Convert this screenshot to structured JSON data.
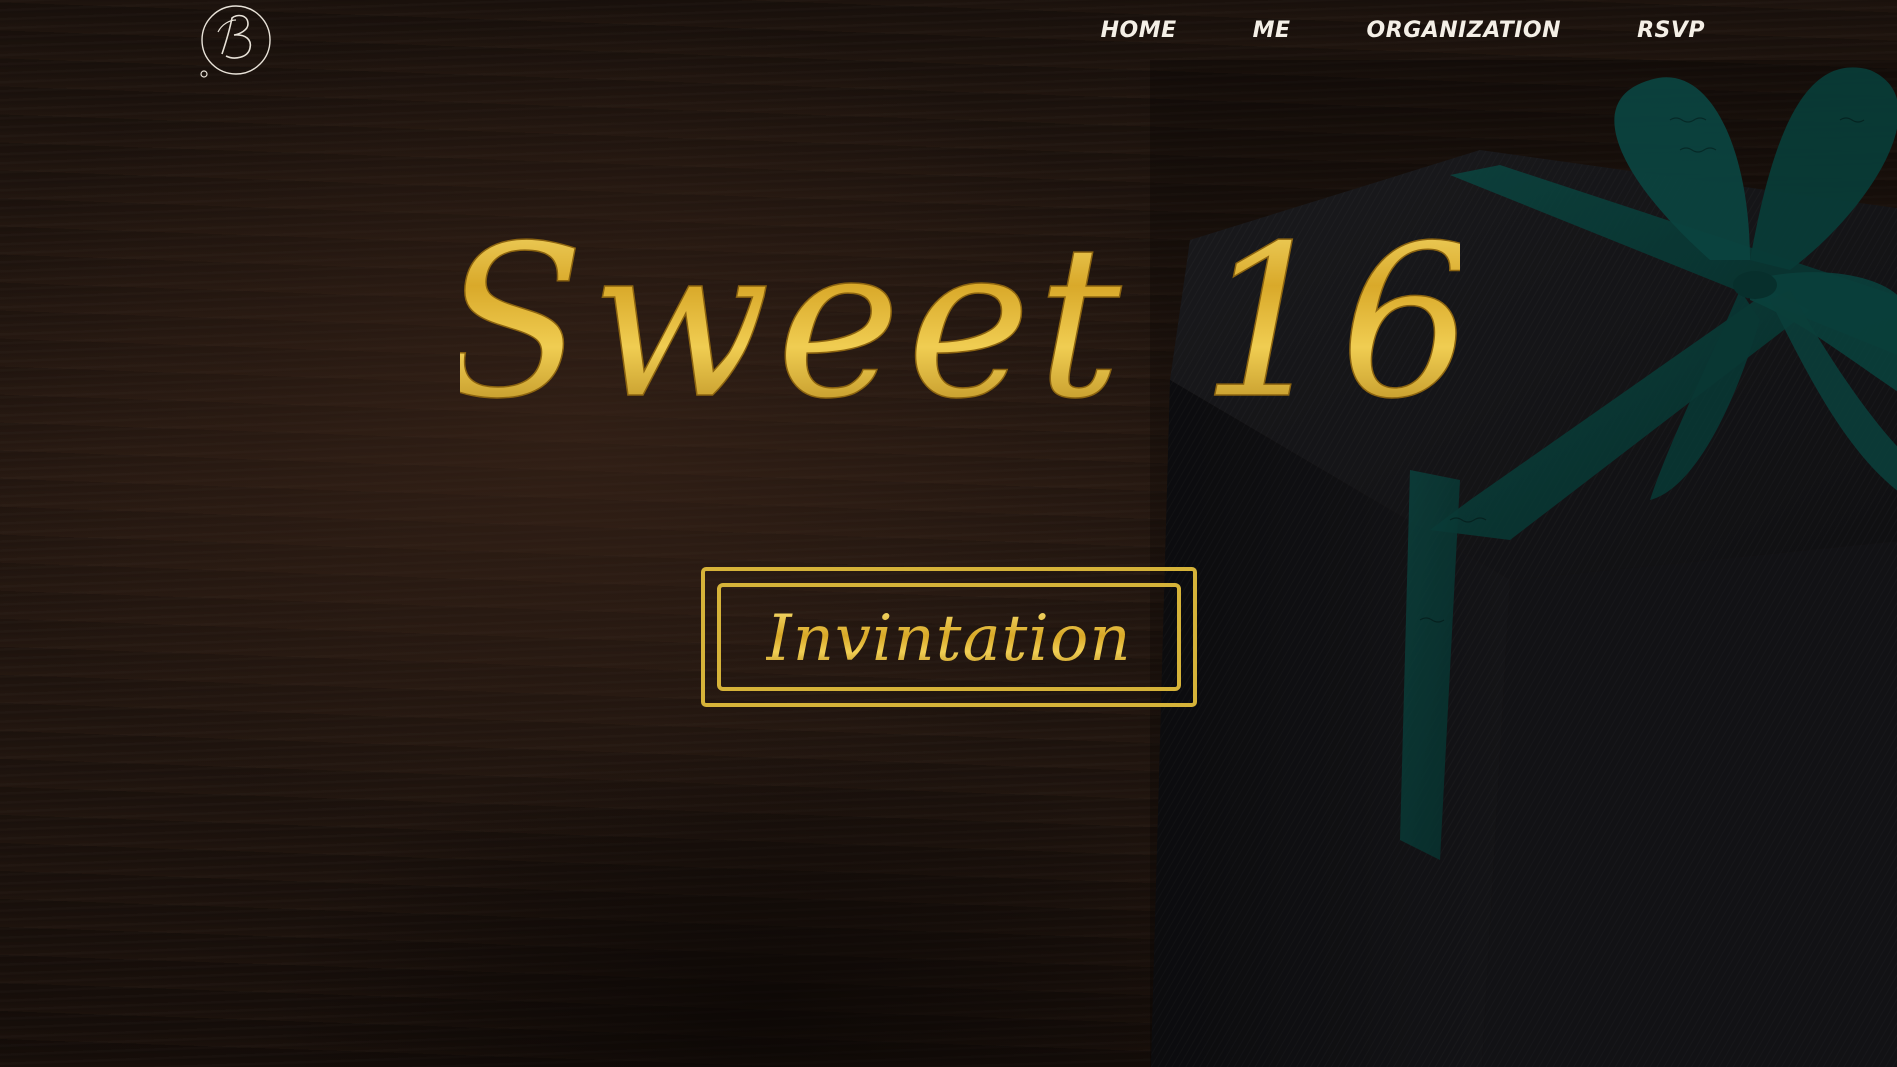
{
  "brand": {
    "logo_letter": "B"
  },
  "nav": {
    "items": [
      {
        "label": "HOME"
      },
      {
        "label": "ME"
      },
      {
        "label": "ORGANIZATION"
      },
      {
        "label": "RSVP"
      }
    ]
  },
  "hero": {
    "title": "Sweet 16",
    "button_label": "Invintation"
  },
  "colors": {
    "gold": "#d6b339",
    "ribbon": "#0d4d47",
    "nav_text": "#f4efe6",
    "background": "#1f140e"
  }
}
